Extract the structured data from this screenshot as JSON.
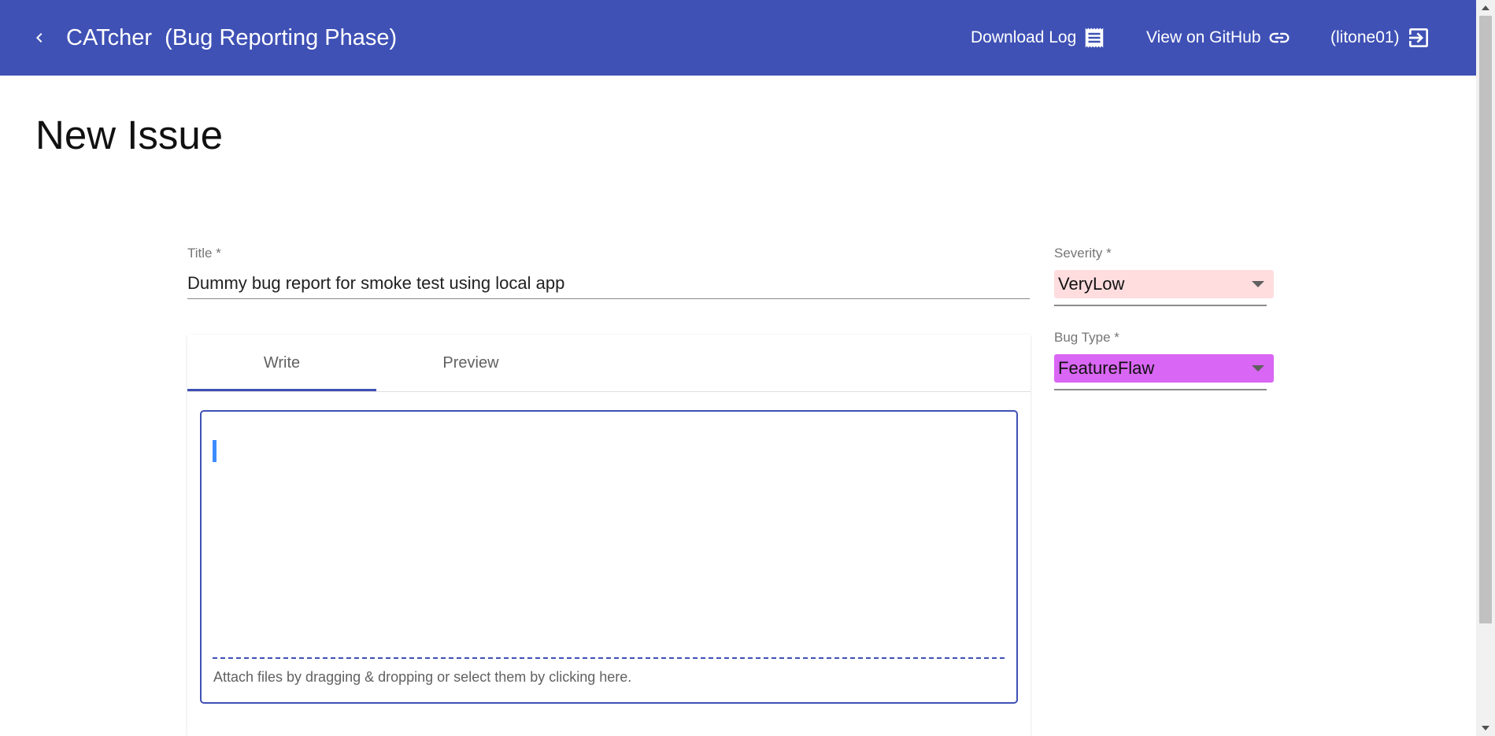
{
  "app": {
    "title": "CATcher  (Bug Reporting Phase)",
    "back_icon": "chevron-left-icon",
    "toolbar_color": "#3f51b5"
  },
  "toolbar": {
    "download_log_label": "Download Log",
    "download_log_icon": "receipt-icon",
    "view_github_label": "View on GitHub",
    "view_github_icon": "link-icon",
    "user_label": "(litone01)",
    "logout_icon": "exit-icon"
  },
  "page": {
    "heading": "New Issue"
  },
  "form": {
    "title_label": "Title *",
    "title_value": "Dummy bug report for smoke test using local app",
    "tabs": [
      {
        "label": "Write",
        "active": true
      },
      {
        "label": "Preview",
        "active": false
      }
    ],
    "description_value": "",
    "attach_hint": "Attach files by dragging & dropping or select them by clicking here.",
    "severity": {
      "label": "Severity *",
      "value": "VeryLow",
      "color": "#ffdddf"
    },
    "bug_type": {
      "label": "Bug Type *",
      "value": "FeatureFlaw",
      "color": "#d966f4"
    }
  }
}
